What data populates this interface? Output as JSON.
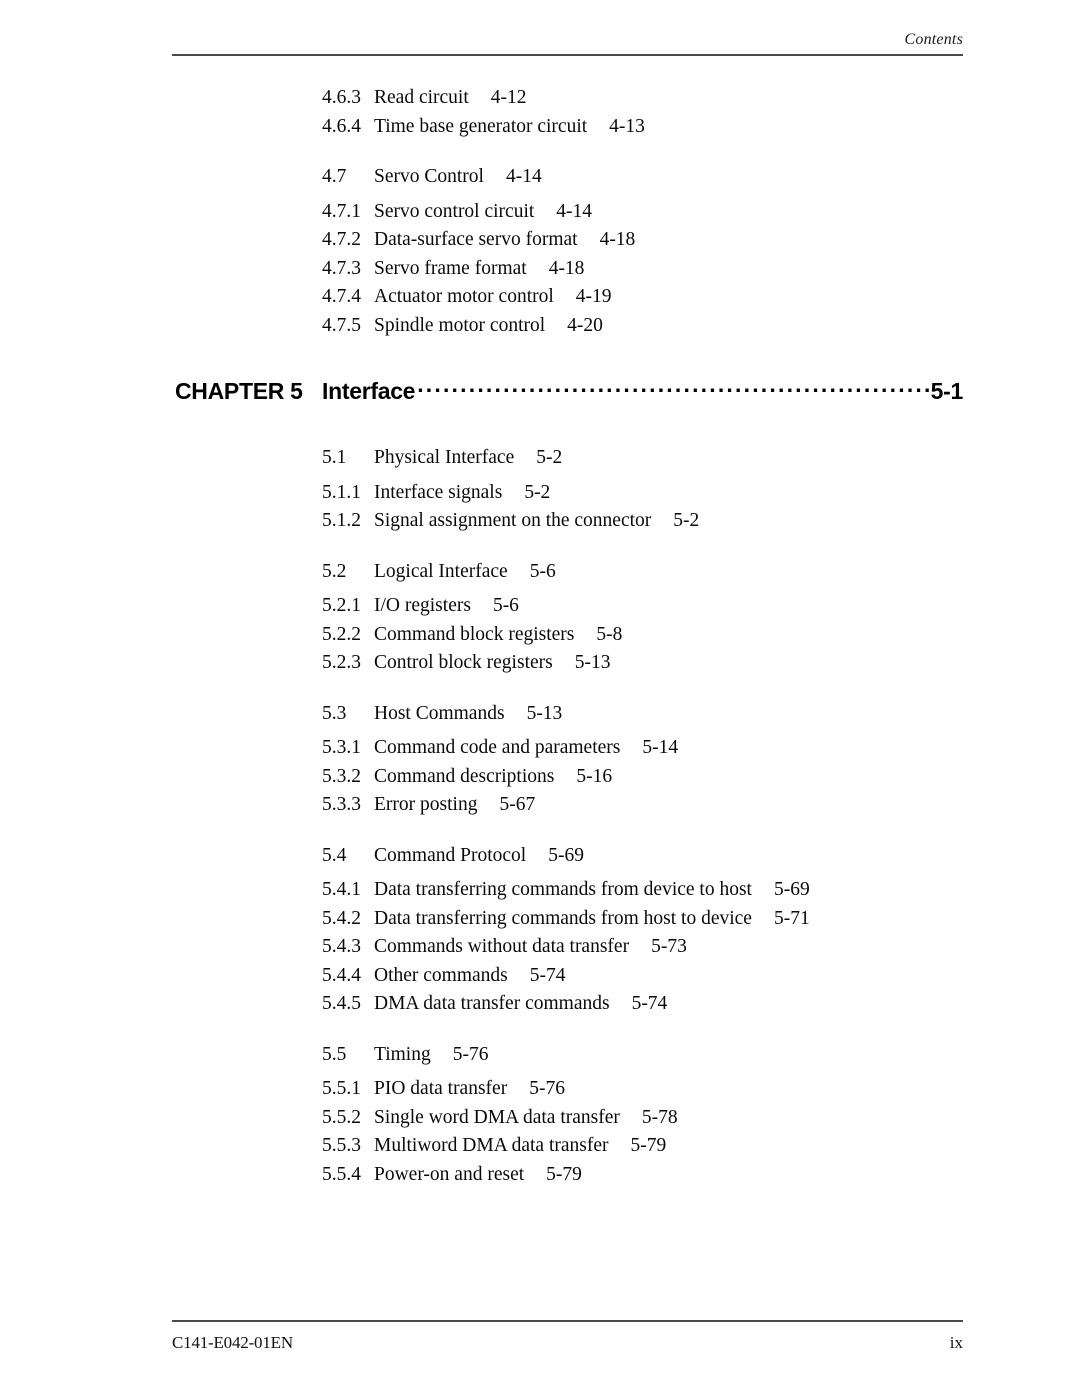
{
  "header": {
    "running_title": "Contents"
  },
  "footer": {
    "document_number": "C141-E042-01EN",
    "page_number": "ix"
  },
  "chapter_heading": {
    "label": "CHAPTER 5",
    "title": "Interface",
    "page": "5-1",
    "leader": "dot-leader"
  },
  "toc_groups": [
    {
      "entries": [
        {
          "number": "4.6.3",
          "title": "Read circuit",
          "page": "4-12",
          "level": 3
        },
        {
          "number": "4.6.4",
          "title": "Time base generator circuit",
          "page": "4-13",
          "level": 3
        }
      ]
    },
    {
      "entries": [
        {
          "number": "4.7",
          "title": "Servo Control",
          "page": "4-14",
          "level": 2
        },
        {
          "number": "4.7.1",
          "title": "Servo control circuit",
          "page": "4-14",
          "level": 3
        },
        {
          "number": "4.7.2",
          "title": "Data-surface servo format",
          "page": "4-18",
          "level": 3
        },
        {
          "number": "4.7.3",
          "title": "Servo frame format",
          "page": "4-18",
          "level": 3
        },
        {
          "number": "4.7.4",
          "title": "Actuator motor control",
          "page": "4-19",
          "level": 3
        },
        {
          "number": "4.7.5",
          "title": "Spindle motor control",
          "page": "4-20",
          "level": 3
        }
      ]
    }
  ],
  "toc_groups_after_chapter": [
    {
      "entries": [
        {
          "number": "5.1",
          "title": "Physical Interface",
          "page": "5-2",
          "level": 2
        },
        {
          "number": "5.1.1",
          "title": "Interface signals",
          "page": "5-2",
          "level": 3
        },
        {
          "number": "5.1.2",
          "title": "Signal assignment on the connector",
          "page": "5-2",
          "level": 3
        }
      ]
    },
    {
      "entries": [
        {
          "number": "5.2",
          "title": "Logical Interface",
          "page": "5-6",
          "level": 2
        },
        {
          "number": "5.2.1",
          "title": "I/O registers",
          "page": "5-6",
          "level": 3
        },
        {
          "number": "5.2.2",
          "title": "Command block registers",
          "page": "5-8",
          "level": 3
        },
        {
          "number": "5.2.3",
          "title": "Control block registers",
          "page": "5-13",
          "level": 3
        }
      ]
    },
    {
      "entries": [
        {
          "number": "5.3",
          "title": "Host Commands",
          "page": "5-13",
          "level": 2
        },
        {
          "number": "5.3.1",
          "title": "Command code and parameters",
          "page": "5-14",
          "level": 3
        },
        {
          "number": "5.3.2",
          "title": "Command descriptions",
          "page": "5-16",
          "level": 3
        },
        {
          "number": "5.3.3",
          "title": "Error posting",
          "page": "5-67",
          "level": 3
        }
      ]
    },
    {
      "entries": [
        {
          "number": "5.4",
          "title": "Command Protocol",
          "page": "5-69",
          "level": 2
        },
        {
          "number": "5.4.1",
          "title": "Data transferring commands from device to host",
          "page": "5-69",
          "level": 3
        },
        {
          "number": "5.4.2",
          "title": "Data transferring commands from host to device",
          "page": "5-71",
          "level": 3
        },
        {
          "number": "5.4.3",
          "title": "Commands without data transfer",
          "page": "5-73",
          "level": 3
        },
        {
          "number": "5.4.4",
          "title": "Other commands",
          "page": "5-74",
          "level": 3
        },
        {
          "number": "5.4.5",
          "title": "DMA data transfer commands",
          "page": "5-74",
          "level": 3
        }
      ]
    },
    {
      "entries": [
        {
          "number": "5.5",
          "title": "Timing",
          "page": "5-76",
          "level": 2
        },
        {
          "number": "5.5.1",
          "title": "PIO data transfer",
          "page": "5-76",
          "level": 3
        },
        {
          "number": "5.5.2",
          "title": "Single word DMA data transfer",
          "page": "5-78",
          "level": 3
        },
        {
          "number": "5.5.3",
          "title": "Multiword DMA data transfer",
          "page": "5-79",
          "level": 3
        },
        {
          "number": "5.5.4",
          "title": "Power-on and reset",
          "page": "5-79",
          "level": 3
        }
      ]
    }
  ]
}
